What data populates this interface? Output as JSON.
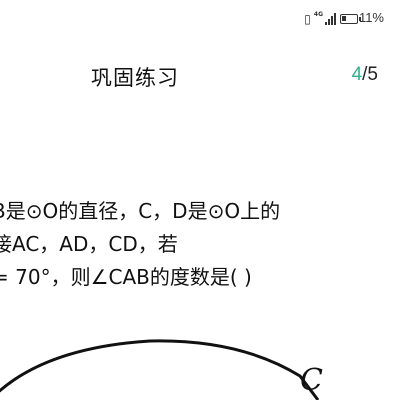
{
  "status": {
    "network_label": "4G",
    "battery_text": "11%"
  },
  "header": {
    "title": "巩固练习",
    "progress_current": "4",
    "progress_total": "/5",
    "progress_accent": "#2bb58a"
  },
  "question": {
    "lines": [
      "B是⊙O的直径，C，D是⊙O上的",
      "接AC，AD，CD，若",
      "= 70°，则∠CAB的度数是( )"
    ]
  },
  "figure": {
    "point_label": "C"
  }
}
